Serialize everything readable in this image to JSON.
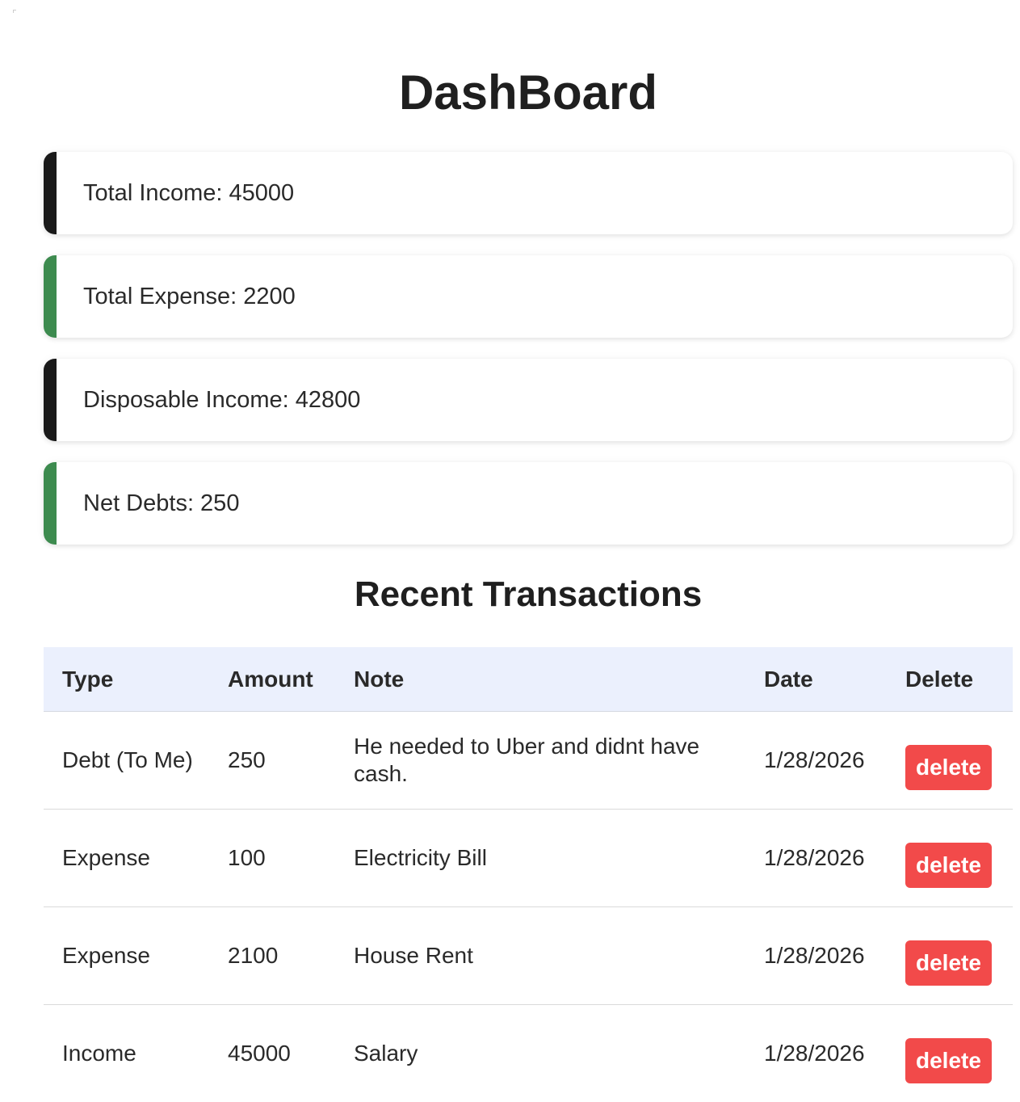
{
  "page": {
    "title": "DashBoard"
  },
  "summary": {
    "cards": [
      {
        "label": "Total Income: 45000",
        "accent": "#1a1a1a"
      },
      {
        "label": "Total Expense: 2200",
        "accent": "#3d8b4f"
      },
      {
        "label": "Disposable Income: 42800",
        "accent": "#1a1a1a"
      },
      {
        "label": "Net Debts: 250",
        "accent": "#3d8b4f"
      }
    ]
  },
  "transactions": {
    "title": "Recent Transactions",
    "headers": {
      "type": "Type",
      "amount": "Amount",
      "note": "Note",
      "date": "Date",
      "delete": "Delete"
    },
    "delete_label": "delete",
    "rows": [
      {
        "type": "Debt (To Me)",
        "amount": "250",
        "note": "He needed to Uber and didnt have cash.",
        "date": "1/28/2026"
      },
      {
        "type": "Expense",
        "amount": "100",
        "note": "Electricity Bill",
        "date": "1/28/2026"
      },
      {
        "type": "Expense",
        "amount": "2100",
        "note": "House Rent",
        "date": "1/28/2026"
      },
      {
        "type": "Income",
        "amount": "45000",
        "note": "Salary",
        "date": "1/28/2026"
      }
    ]
  },
  "colors": {
    "header_bg": "#ebf0fd",
    "delete_button": "#f24a4a",
    "accent_dark": "#1a1a1a",
    "accent_green": "#3d8b4f"
  }
}
